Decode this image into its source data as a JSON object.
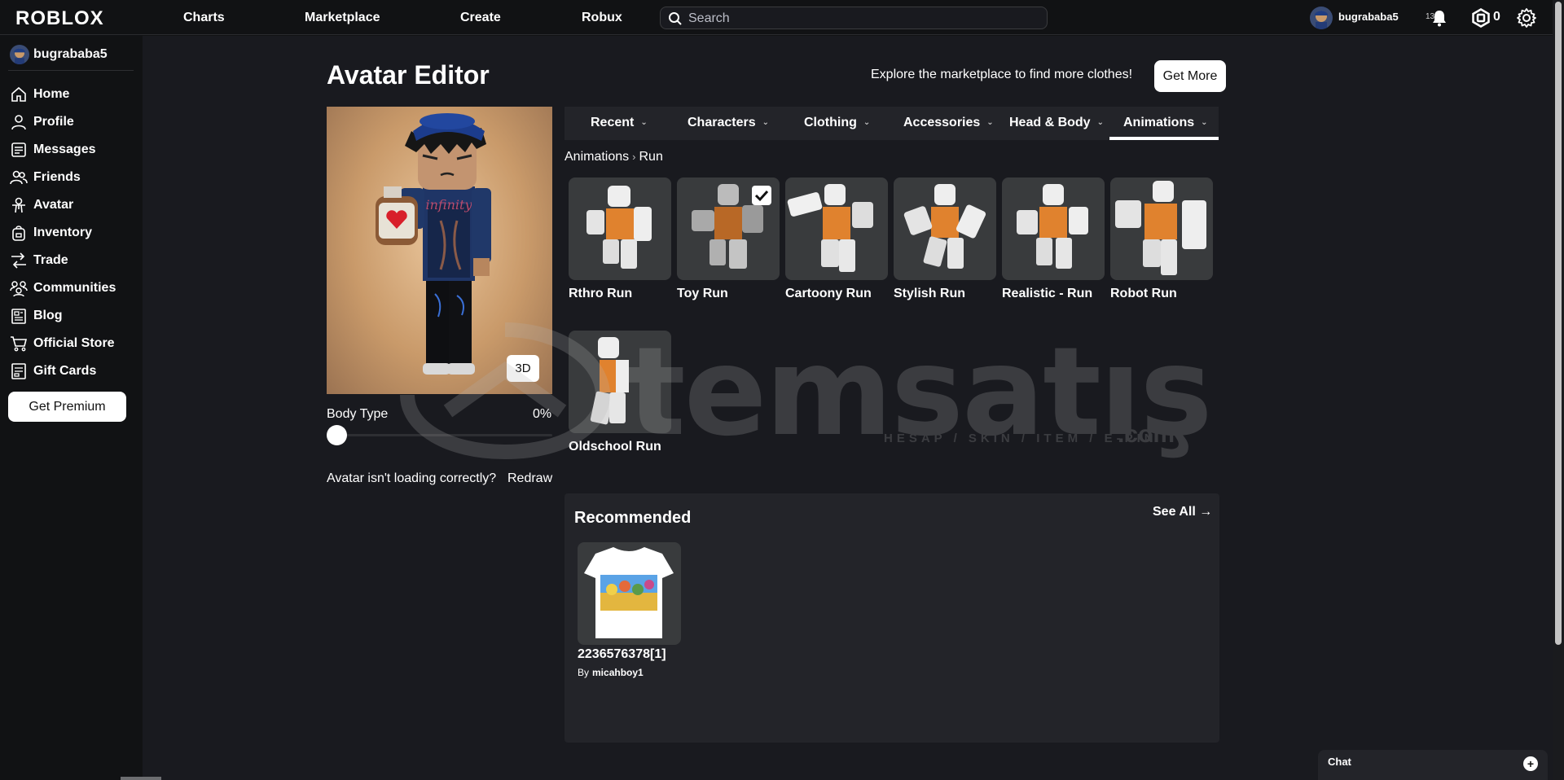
{
  "topbar": {
    "logo": "ROBLOX",
    "nav": [
      "Charts",
      "Marketplace",
      "Create",
      "Robux"
    ],
    "search_placeholder": "Search",
    "username": "bugrababa5",
    "age_badge": "13+",
    "robux_balance": "0"
  },
  "sidebar": {
    "username": "bugrababa5",
    "items": [
      {
        "label": "Home",
        "icon": "home-icon"
      },
      {
        "label": "Profile",
        "icon": "profile-icon"
      },
      {
        "label": "Messages",
        "icon": "messages-icon"
      },
      {
        "label": "Friends",
        "icon": "friends-icon"
      },
      {
        "label": "Avatar",
        "icon": "avatar-icon"
      },
      {
        "label": "Inventory",
        "icon": "inventory-icon"
      },
      {
        "label": "Trade",
        "icon": "trade-icon"
      },
      {
        "label": "Communities",
        "icon": "communities-icon"
      },
      {
        "label": "Blog",
        "icon": "blog-icon"
      },
      {
        "label": "Official Store",
        "icon": "cart-icon"
      },
      {
        "label": "Gift Cards",
        "icon": "gift-card-icon"
      }
    ],
    "premium_button": "Get Premium"
  },
  "editor": {
    "title": "Avatar Editor",
    "explore_text": "Explore the marketplace to find more clothes!",
    "get_more": "Get More",
    "view_toggle": "3D",
    "body_type_label": "Body Type",
    "body_type_value": "0%",
    "body_type_fraction": 0,
    "redraw_question": "Avatar isn't loading correctly?",
    "redraw_link": "Redraw"
  },
  "tabs": [
    {
      "label": "Recent"
    },
    {
      "label": "Characters"
    },
    {
      "label": "Clothing"
    },
    {
      "label": "Accessories"
    },
    {
      "label": "Head & Body"
    },
    {
      "label": "Animations",
      "active": true
    }
  ],
  "breadcrumb": {
    "parent": "Animations",
    "current": "Run"
  },
  "items": [
    {
      "name": "Rthro Run",
      "selected": false
    },
    {
      "name": "Toy Run",
      "selected": true
    },
    {
      "name": "Cartoony Run",
      "selected": false
    },
    {
      "name": "Stylish Run",
      "selected": false
    },
    {
      "name": "Realistic - Run",
      "selected": false
    },
    {
      "name": "Robot Run",
      "selected": false
    },
    {
      "name": "Oldschool Run",
      "selected": false
    }
  ],
  "recommended": {
    "title": "Recommended",
    "see_all": "See All",
    "item_name": "2236576378[1]",
    "by_label": "By",
    "creator": "micahboy1"
  },
  "chat": {
    "label": "Chat"
  },
  "watermark": {
    "main": "temsatış",
    "sub": "HESAP / SKIN / ITEM / E-PIN",
    "suffix": ".com"
  },
  "colors": {
    "background": "#191a1f",
    "topbar": "#111214",
    "panel": "#232429",
    "thumb_bg": "#393b3d",
    "torso_orange": "#e0822e"
  }
}
